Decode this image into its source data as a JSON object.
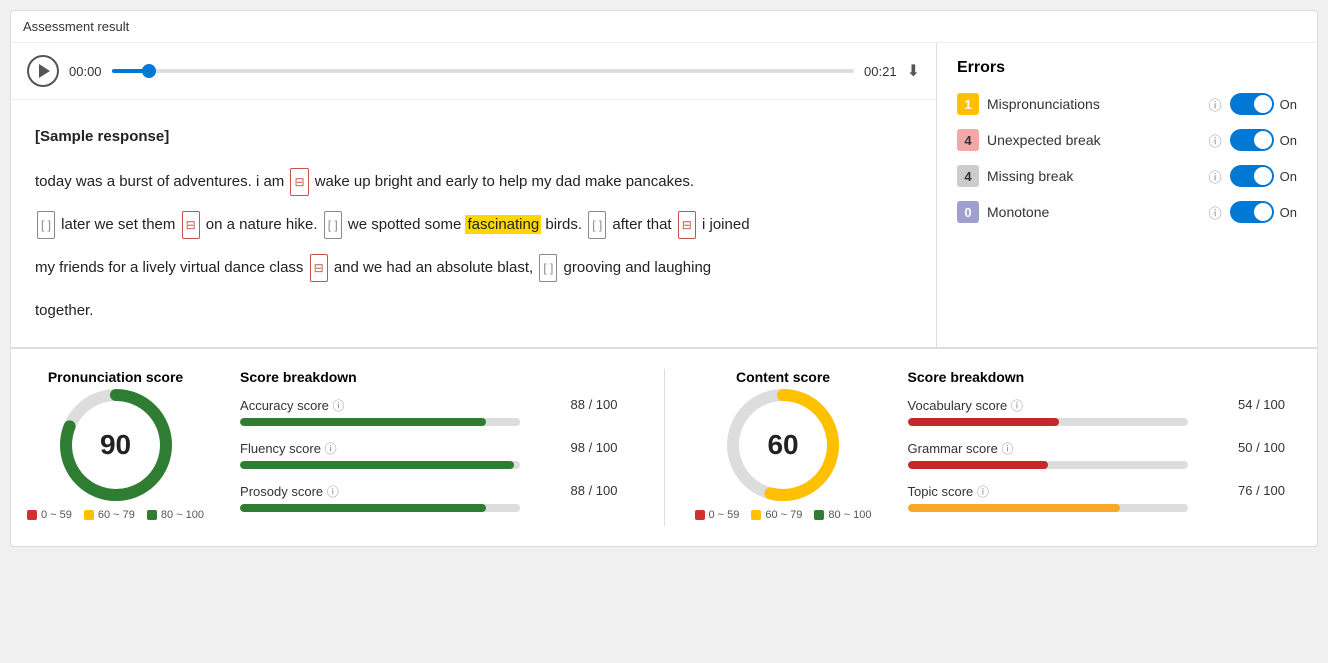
{
  "page": {
    "title": "Assessment result"
  },
  "audio": {
    "time_start": "00:00",
    "time_end": "00:21",
    "progress_percent": 5
  },
  "text": {
    "sample_label": "[Sample response]",
    "paragraph": "today was a burst of adventures. i am",
    "word_highlighted": "fascinating",
    "line1": "today was a burst of adventures. i am [R] wake up bright and early to help my dad make pancakes.",
    "line2": "[ ] later we set them [R] on a nature hike. [ ] we spotted some fascinating birds. [ ] after that [R] i joined",
    "line3": "my friends for a lively virtual dance class [R] and we had an absolute blast, [ ] grooving and laughing",
    "line4": "together."
  },
  "errors": {
    "title": "Errors",
    "items": [
      {
        "badge": "1",
        "badge_type": "yellow",
        "label": "Mispronunciations",
        "toggle": "On"
      },
      {
        "badge": "4",
        "badge_type": "pink",
        "label": "Unexpected break",
        "toggle": "On"
      },
      {
        "badge": "4",
        "badge_type": "gray",
        "label": "Missing break",
        "toggle": "On"
      },
      {
        "badge": "0",
        "badge_type": "purple",
        "label": "Monotone",
        "toggle": "On"
      }
    ]
  },
  "pronunciation": {
    "title": "Pronunciation score",
    "score": "90",
    "donut_green_pct": 90,
    "breakdown_title": "Score breakdown",
    "scores": [
      {
        "label": "Accuracy score",
        "value": "88 / 100",
        "pct": 88,
        "color": "green"
      },
      {
        "label": "Fluency score",
        "value": "98 / 100",
        "pct": 98,
        "color": "green"
      },
      {
        "label": "Prosody score",
        "value": "88 / 100",
        "pct": 88,
        "color": "green"
      }
    ],
    "legend": [
      {
        "color": "red",
        "label": "0 ~ 59"
      },
      {
        "color": "yellow",
        "label": "60 ~ 79"
      },
      {
        "color": "green",
        "label": "80 ~ 100"
      }
    ]
  },
  "content": {
    "title": "Content score",
    "score": "60",
    "donut_yellow_pct": 60,
    "breakdown_title": "Score breakdown",
    "scores": [
      {
        "label": "Vocabulary score",
        "value": "54 / 100",
        "pct": 54,
        "color": "red"
      },
      {
        "label": "Grammar score",
        "value": "50 / 100",
        "pct": 50,
        "color": "red"
      },
      {
        "label": "Topic score",
        "value": "76 / 100",
        "pct": 76,
        "color": "yellow"
      }
    ],
    "legend": [
      {
        "color": "red",
        "label": "0 ~ 59"
      },
      {
        "color": "yellow",
        "label": "60 ~ 79"
      },
      {
        "color": "green",
        "label": "80 ~ 100"
      }
    ]
  }
}
